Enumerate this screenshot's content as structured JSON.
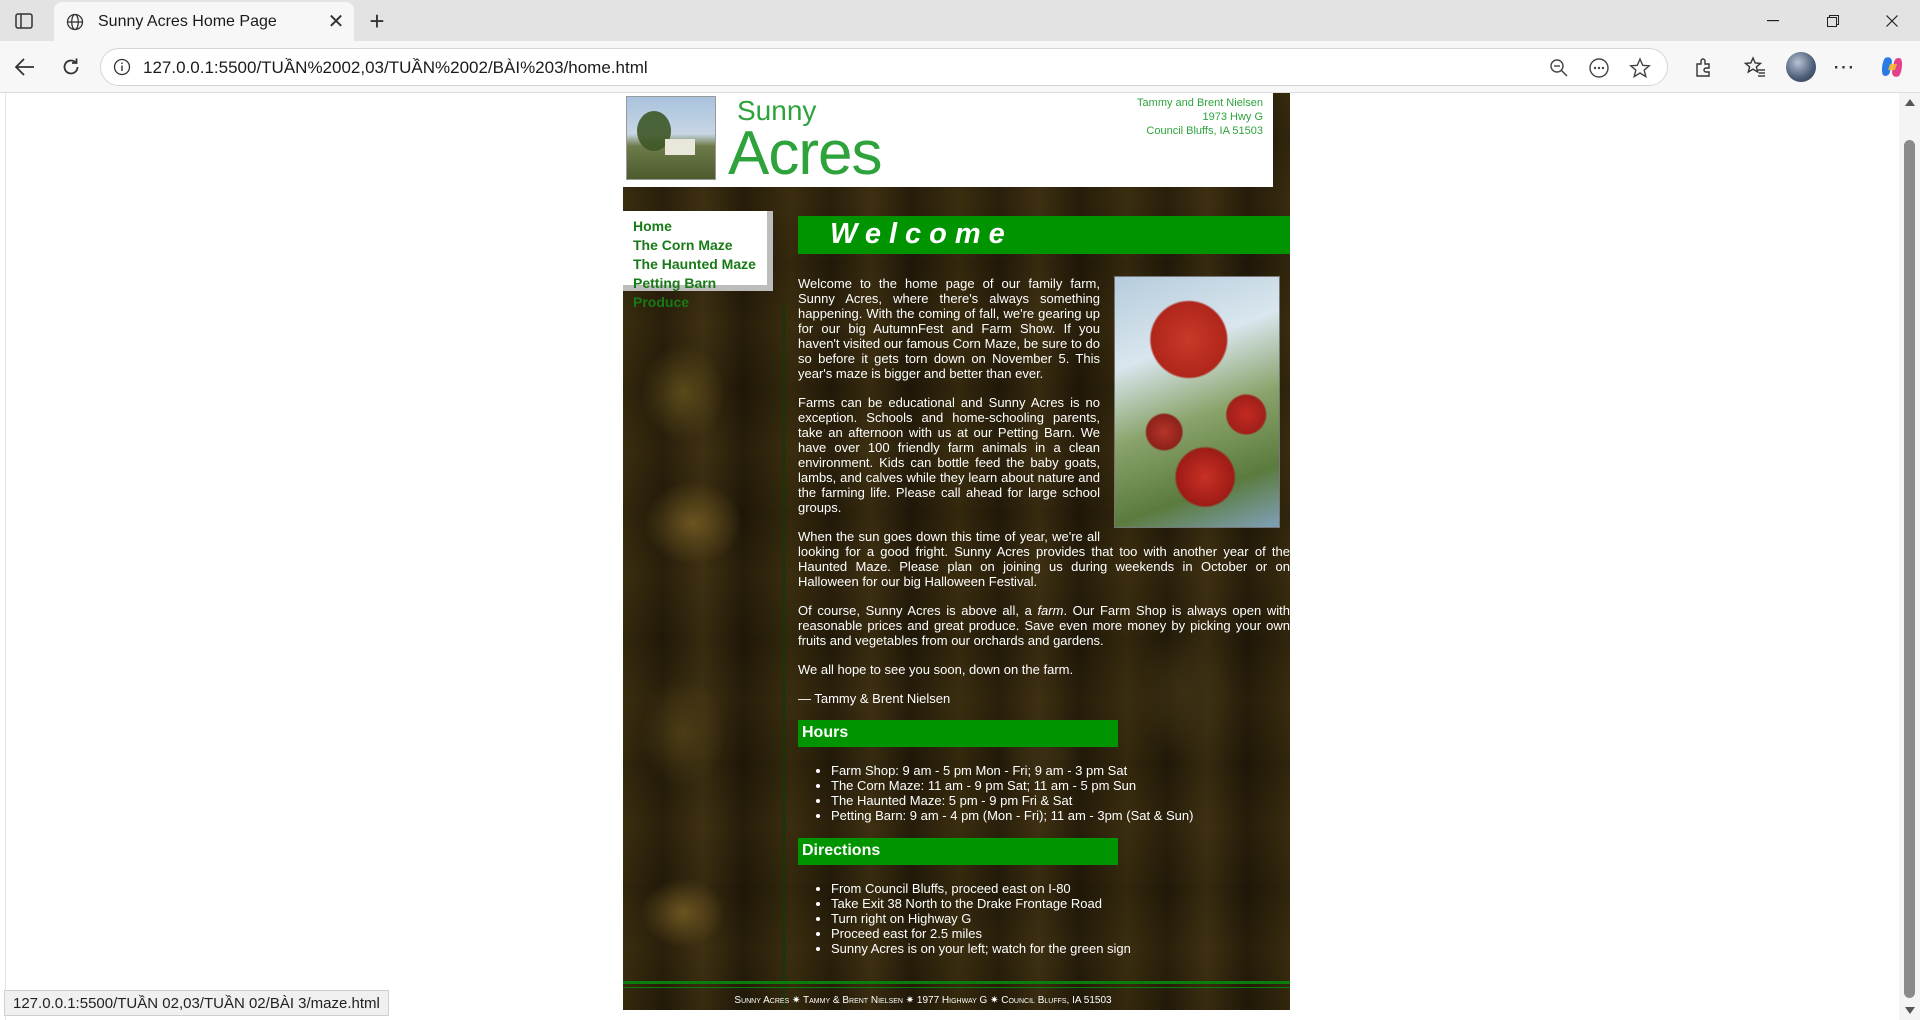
{
  "browser": {
    "tab_title": "Sunny Acres Home Page",
    "url": "127.0.0.1:5500/TUẦN%2002,03/TUẦN%2002/BÀI%203/home.html",
    "status_url": "127.0.0.1:5500/TUẦN 02,03/TUẦN 02/BÀI 3/maze.html"
  },
  "header": {
    "logo_top": "Sunny",
    "logo_bottom": "Acres",
    "address": [
      "Tammy and Brent Nielsen",
      "1973 Hwy G",
      "Council Bluffs, IA  51503"
    ]
  },
  "nav": {
    "items": [
      "Home",
      "The Corn Maze",
      "The Haunted Maze",
      "Petting Barn",
      "Produce"
    ]
  },
  "main": {
    "welcome": "Welcome",
    "paragraphs": [
      "Welcome to the home page of our family farm, Sunny Acres, where there's always something happening. With the coming of fall, we're gearing up for our big AutumnFest and Farm Show. If you haven't visited our famous Corn Maze, be sure to do so before it gets torn down on November 5. This year's maze is bigger and better than ever.",
      "Farms can be educational and Sunny Acres is no exception. Schools and home-schooling parents, take an afternoon with us at our Petting Barn. We have over 100 friendly farm animals in a clean environment. Kids can bottle feed the baby goats, lambs, and calves while they learn about nature and the farming life. Please call ahead for large school groups.",
      "When the sun goes down this time of year, we're all looking for a good fright. Sunny Acres provides that too with another year of the Haunted Maze. Please plan on joining us during weekends in October or on Halloween for our big Halloween Festival.",
      "We all hope to see you soon, down on the farm.",
      "— Tammy & Brent Nielsen"
    ],
    "paragraph4_before": "Of course, Sunny Acres is above all, a ",
    "paragraph4_em": "farm",
    "paragraph4_after": ". Our Farm Shop is always open with reasonable prices and great produce. Save even more money by picking your own fruits and vegetables from our orchards and gardens."
  },
  "hours": {
    "title": "Hours",
    "items": [
      "Farm Shop: 9 am - 5 pm Mon - Fri; 9 am - 3 pm Sat",
      "The Corn Maze: 11 am - 9 pm Sat; 11 am - 5 pm Sun",
      "The Haunted Maze: 5 pm - 9 pm Fri & Sat",
      "Petting Barn: 9 am - 4 pm (Mon - Fri); 11 am - 3pm (Sat & Sun)"
    ]
  },
  "directions": {
    "title": "Directions",
    "items": [
      "From Council Bluffs, proceed east on I-80",
      "Take Exit 38 North to the Drake Frontage Road",
      "Turn right on Highway G",
      "Proceed east for 2.5 miles",
      "Sunny Acres is on your left; watch for the green sign"
    ]
  },
  "footer": {
    "text": "Sunny Acres ✷ Tammy & Brent Nielsen ✷ 1977 Highway G ✷ Council Bluffs, IA   51503"
  },
  "colors": {
    "accent_green": "#009400",
    "nav_link": "#187a16",
    "logo_green": "#2ea33c"
  }
}
